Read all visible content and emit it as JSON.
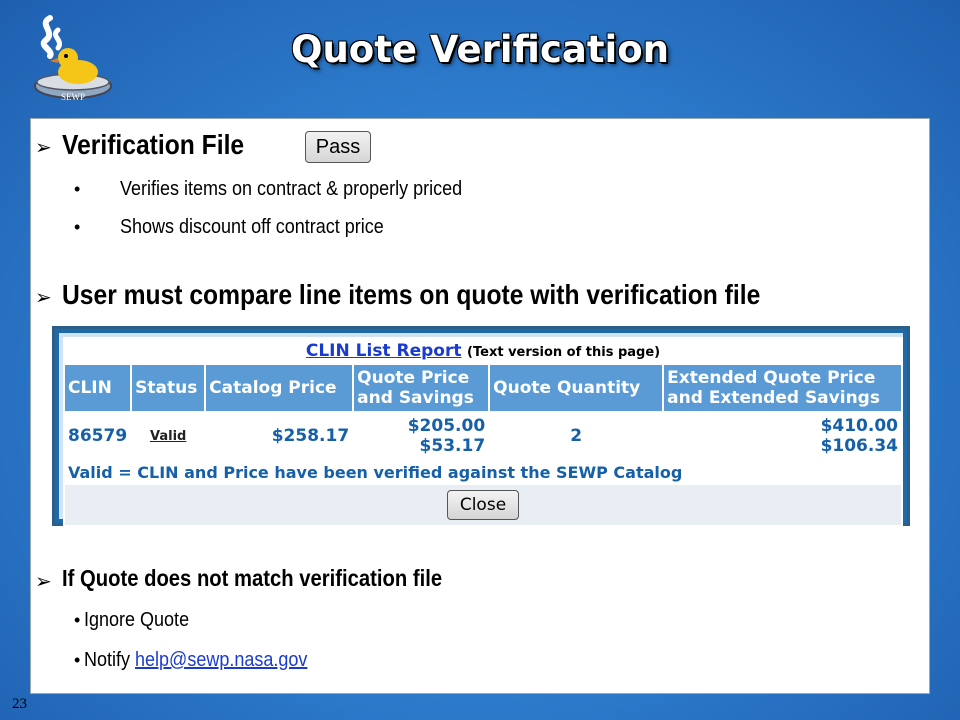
{
  "logo": {
    "label": "SEWP"
  },
  "title": "Quote Verification",
  "section1": {
    "heading": "Verification File",
    "pass_button": "Pass",
    "bullets": [
      "Verifies items on contract & properly priced",
      "Shows discount off contract price"
    ]
  },
  "section2": {
    "heading": "User must compare line items on quote with verification file"
  },
  "report": {
    "title_link": "CLIN List Report",
    "title_suffix": "(Text version of this page)",
    "columns": [
      "CLIN",
      "Status",
      "Catalog Price",
      "Quote Price and Savings",
      "Quote Quantity",
      "Extended Quote Price and Extended Savings"
    ],
    "row": {
      "clin": "86579",
      "status": "Valid",
      "catalog_price": "$258.17",
      "quote_price": "$205.00",
      "savings": "$53.17",
      "quantity": "2",
      "extended_price": "$410.00",
      "extended_savings": "$106.34"
    },
    "note": "Valid = CLIN and Price have been verified against the SEWP Catalog",
    "close_button": "Close"
  },
  "section3": {
    "heading": "If Quote does not match verification file",
    "bullets": [
      "Ignore Quote"
    ],
    "notify_prefix": "Notify ",
    "notify_email": "help@sewp.nasa.gov"
  },
  "slide_number": "23"
}
